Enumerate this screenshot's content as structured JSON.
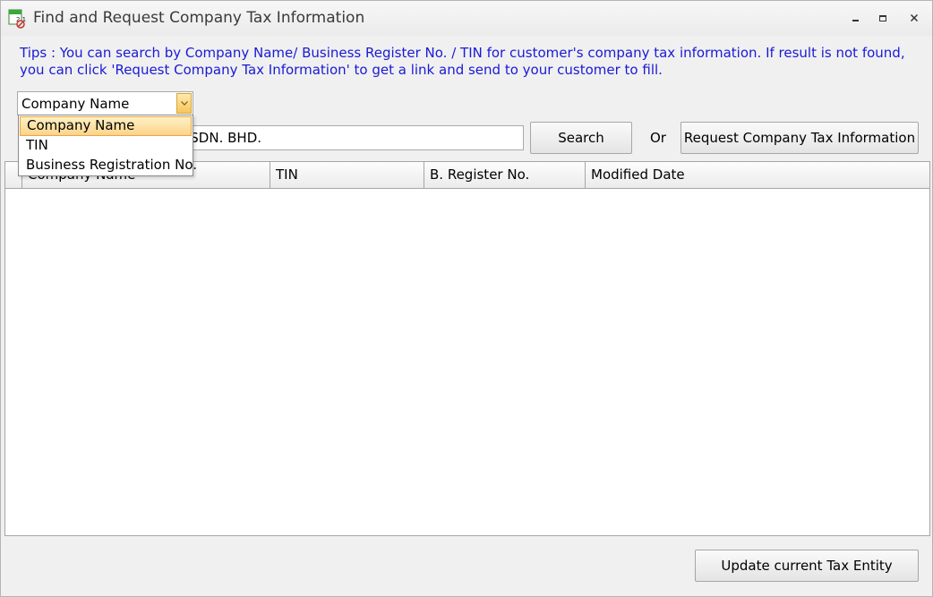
{
  "window": {
    "title": "Find and Request Company Tax Information",
    "icon": "tax-app-icon",
    "controls": {
      "minimize": "▪",
      "maximize": "◘",
      "close": "✕"
    }
  },
  "tips": "Tips : You can search by Company Name/ Business Register No. / TIN for customer's company tax information. If result is not found, you can click 'Request Company Tax Information' to get a link and send to your customer to fill.",
  "search": {
    "field_selector": {
      "value": "Company Name",
      "options": [
        "Company Name",
        "TIN",
        "Business Registration No."
      ],
      "selected_index": 0
    },
    "input_value": "S SDN. BHD.",
    "search_label": "Search",
    "or_label": "Or",
    "request_label": "Request Company Tax Information"
  },
  "grid": {
    "columns": [
      "Company Name",
      "TIN",
      "B. Register No.",
      "Modified Date"
    ],
    "rows": []
  },
  "footer": {
    "update_label": "Update current Tax Entity"
  },
  "colors": {
    "tips_text": "#1a1ad6",
    "selection_highlight": "#fbd48a",
    "window_bg": "#f0f0f0"
  }
}
